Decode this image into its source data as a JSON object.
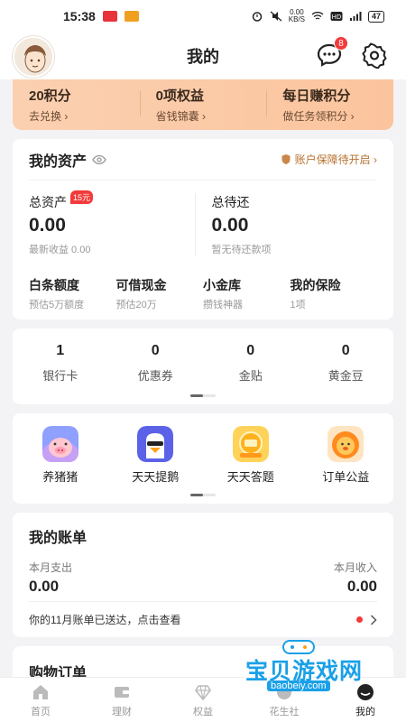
{
  "status": {
    "time": "15:38",
    "net_speed_value": "0.00",
    "net_speed_unit": "KB/S",
    "battery": "47"
  },
  "header": {
    "title": "我的",
    "message_count": "8"
  },
  "points": [
    {
      "title": "20积分",
      "sub": "去兑换 ›"
    },
    {
      "title": "0项权益",
      "sub": "省钱锦囊 ›"
    },
    {
      "title": "每日赚积分",
      "sub": "做任务领积分 ›"
    }
  ],
  "assets": {
    "title": "我的资产",
    "protect": "账户保障待开启 ›",
    "total_label": "总资产",
    "total_tag": "15元",
    "total_amount": "0.00",
    "total_hint": "最新收益 0.00",
    "due_label": "总待还",
    "due_amount": "0.00",
    "due_hint": "暂无待还款项",
    "quick": [
      {
        "name": "白条额度",
        "sub": "预估5万额度"
      },
      {
        "name": "可借现金",
        "sub": "预估20万"
      },
      {
        "name": "小金库",
        "sub": "攒钱神器"
      },
      {
        "name": "我的保险",
        "sub": "1项"
      }
    ]
  },
  "counts": [
    {
      "num": "1",
      "label": "银行卡"
    },
    {
      "num": "0",
      "label": "优惠券"
    },
    {
      "num": "0",
      "label": "金贴"
    },
    {
      "num": "0",
      "label": "黄金豆"
    }
  ],
  "services": [
    {
      "label": "养猪猪",
      "icon": "pig-icon",
      "color": "#7a8cf5"
    },
    {
      "label": "天天提鹅",
      "icon": "goose-icon",
      "color": "#6a6ff0"
    },
    {
      "label": "天天答题",
      "icon": "coin-icon",
      "color": "#ffb21c"
    },
    {
      "label": "订单公益",
      "icon": "lion-icon",
      "color": "#ff8a1f"
    }
  ],
  "bill": {
    "title": "我的账单",
    "out_label": "本月支出",
    "out_amount": "0.00",
    "in_label": "本月收入",
    "in_amount": "0.00",
    "notice": "你的11月账单已送达，点击查看"
  },
  "orders": {
    "title": "购物订单"
  },
  "tabs": [
    {
      "label": "首页",
      "icon": "home-icon"
    },
    {
      "label": "理财",
      "icon": "wallet-icon"
    },
    {
      "label": "权益",
      "icon": "diamond-icon"
    },
    {
      "label": "花生社",
      "icon": "community-icon"
    },
    {
      "label": "我的",
      "icon": "profile-icon"
    }
  ],
  "watermark": {
    "text": "宝贝游戏网",
    "url": "baobeiy.com"
  }
}
